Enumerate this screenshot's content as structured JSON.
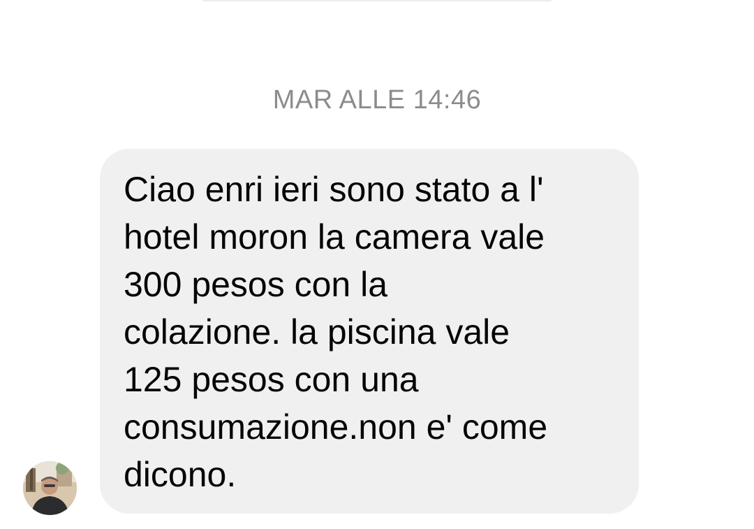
{
  "conversation": {
    "timestamp": "MAR ALLE 14:46",
    "messages": [
      {
        "direction": "incoming",
        "text": "Ciao enri ieri sono stato a l'\nhotel moron la camera vale\n300 pesos con la\ncolazione. la piscina vale\n125 pesos con una\nconsumazione.non e' come\ndicono."
      }
    ]
  },
  "colors": {
    "background": "#ffffff",
    "bubble": "#f0f0f0",
    "message_text": "#050505",
    "timestamp_text": "#8c8c8c"
  },
  "icons": {
    "avatar": "sender-avatar-photo"
  }
}
